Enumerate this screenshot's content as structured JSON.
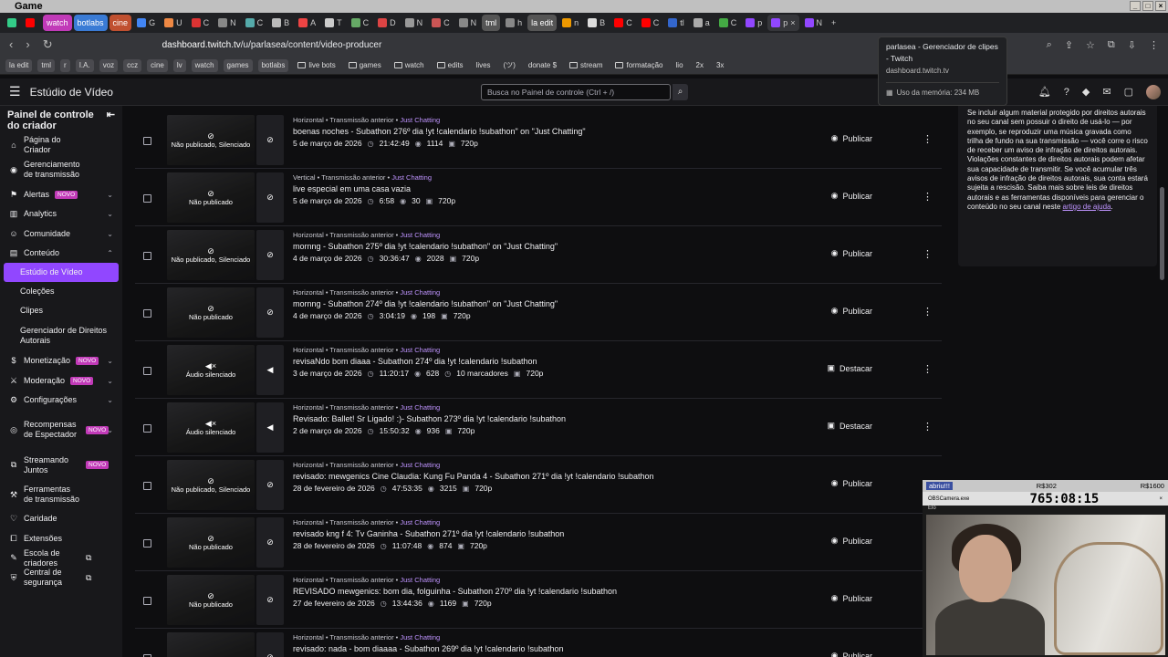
{
  "window": {
    "title": "Game"
  },
  "tabs": [
    {
      "label": "",
      "color": "#ff0000"
    },
    {
      "label": "watch",
      "color": "#c13ab8",
      "pill": true
    },
    {
      "label": "botlabs",
      "color": "#3a7bd5",
      "pill": true
    },
    {
      "label": "cine",
      "color": "#c05030",
      "pill": true
    },
    {
      "label": "G",
      "color": "#4285f4"
    },
    {
      "label": "U",
      "color": "#e84"
    },
    {
      "label": "C",
      "color": "#d33"
    },
    {
      "label": "N",
      "color": "#888"
    },
    {
      "label": "C",
      "color": "#5aa"
    },
    {
      "label": "B",
      "color": "#bbb"
    },
    {
      "label": "A",
      "color": "#e44"
    },
    {
      "label": "T",
      "color": "#ccc"
    },
    {
      "label": "C",
      "color": "#6a6"
    },
    {
      "label": "D",
      "color": "#d44"
    },
    {
      "label": "N",
      "color": "#999"
    },
    {
      "label": "C",
      "color": "#c55"
    },
    {
      "label": "N",
      "color": "#888"
    },
    {
      "label": "tml",
      "color": "#555",
      "pill": true
    },
    {
      "label": "h",
      "color": "#888"
    },
    {
      "label": "la edit",
      "color": "#555",
      "pill": true
    },
    {
      "label": "n",
      "color": "#e90"
    },
    {
      "label": "B",
      "color": "#ddd"
    },
    {
      "label": "C",
      "color": "#f00"
    },
    {
      "label": "C",
      "color": "#f00"
    },
    {
      "label": "tl",
      "color": "#36c"
    },
    {
      "label": "a",
      "color": "#aaa"
    },
    {
      "label": "C",
      "color": "#4a4"
    },
    {
      "label": "p",
      "color": "#9147ff"
    },
    {
      "label": "p",
      "color": "#9147ff",
      "active": true
    },
    {
      "label": "N",
      "color": "#9147ff"
    }
  ],
  "address": {
    "host": "dashboard.twitch.tv",
    "path": "/u/parlasea/content/video-producer"
  },
  "bookmarks": [
    {
      "label": "la edit",
      "pill": true
    },
    {
      "label": "tml",
      "pill": true
    },
    {
      "label": "r",
      "pill": true
    },
    {
      "label": "I.A.",
      "pill": true
    },
    {
      "label": "voz",
      "pill": true
    },
    {
      "label": "ccz",
      "pill": true
    },
    {
      "label": "cine",
      "pill": true
    },
    {
      "label": "lv",
      "pill": true
    },
    {
      "label": "watch",
      "pill": true
    },
    {
      "label": "games",
      "pill": true
    },
    {
      "label": "botlabs",
      "pill": true
    },
    {
      "label": "live bots",
      "folder": true
    },
    {
      "label": "games",
      "folder": true
    },
    {
      "label": "watch",
      "folder": true
    },
    {
      "label": "edits",
      "folder": true
    },
    {
      "label": "lives"
    },
    {
      "label": "(ツ)"
    },
    {
      "label": "donate $"
    },
    {
      "label": "stream",
      "folder": true
    },
    {
      "label": "formatação",
      "folder": true
    },
    {
      "label": "lio"
    },
    {
      "label": "2x"
    },
    {
      "label": "3x"
    }
  ],
  "tooltip": {
    "title": "parlasea - Gerenciador de clipes - Twitch",
    "host": "dashboard.twitch.tv",
    "memory": "Uso da memória: 234 MB"
  },
  "topnav": {
    "title": "Estúdio de Vídeo",
    "search_placeholder": "Busca no Painel de controle (Ctrl + /)"
  },
  "sidebar": {
    "heading": "Painel de controle do criador",
    "items": [
      {
        "label": "Página do Criador",
        "icon": "home-icon",
        "glyph": "⌂"
      },
      {
        "label": "Gerenciamento de transmissão",
        "icon": "broadcast-icon",
        "glyph": "◉"
      },
      {
        "label": "Alertas",
        "icon": "alert-icon",
        "glyph": "⚑",
        "badge": "NOVO",
        "chev": "⌄"
      },
      {
        "label": "Analytics",
        "icon": "chart-icon",
        "glyph": "▥",
        "chev": "⌄"
      },
      {
        "label": "Comunidade",
        "icon": "community-icon",
        "glyph": "☺",
        "chev": "⌄"
      },
      {
        "label": "Conteúdo",
        "icon": "content-icon",
        "glyph": "▤",
        "chev": "⌃"
      }
    ],
    "sub": [
      "Estúdio de Vídeo",
      "Coleções",
      "Clipes",
      "Gerenciador de Direitos Autorais"
    ],
    "items2": [
      {
        "label": "Monetização",
        "icon": "money-icon",
        "glyph": "$",
        "badge": "NOVO",
        "chev": "⌄"
      },
      {
        "label": "Moderação",
        "icon": "mod-icon",
        "glyph": "⚔",
        "badge": "NOVO",
        "chev": "⌄"
      },
      {
        "label": "Configurações",
        "icon": "gear-icon",
        "glyph": "⚙",
        "chev": "⌄"
      },
      {
        "label": "Recompensas de Espectador",
        "icon": "reward-icon",
        "glyph": "◎",
        "badge": "NOVO",
        "chev": "⌄"
      },
      {
        "label": "Streamando Juntos",
        "icon": "together-icon",
        "glyph": "⧉",
        "badge": "NOVO"
      },
      {
        "label": "Ferramentas de transmissão",
        "icon": "tools-icon",
        "glyph": "⚒"
      },
      {
        "label": "Caridade",
        "icon": "charity-icon",
        "glyph": "♡"
      },
      {
        "label": "Extensões",
        "icon": "extension-icon",
        "glyph": "⧠"
      },
      {
        "label": "Escola de criadores",
        "icon": "school-icon",
        "glyph": "✎",
        "ext": "⧉"
      },
      {
        "label": "Central de segurança",
        "icon": "shield-icon",
        "glyph": "⛨",
        "ext": "⧉"
      }
    ]
  },
  "videos": [
    {
      "meta": "Horizontal • Transmissão anterior •",
      "cat": "Just Chatting",
      "title": "boenas noches - Subathon 276º dia !yt !calendario !subathon\" on \"Just Chatting\"",
      "date": "5 de março de 2026",
      "dur": "21:42:49",
      "views": "1114",
      "markers": "",
      "res": "720p",
      "overlay": "Não publicado, Silenciado",
      "action": "Publicar"
    },
    {
      "meta": "Vertical • Transmissão anterior •",
      "cat": "Just Chatting",
      "title": "live especial em uma casa vazia",
      "date": "5 de março de 2026",
      "dur": "6:58",
      "views": "30",
      "markers": "",
      "res": "720p",
      "overlay": "Não publicado",
      "action": "Publicar"
    },
    {
      "meta": "Horizontal • Transmissão anterior •",
      "cat": "Just Chatting",
      "title": "mornng - Subathon 275º dia !yt !calendario !subathon\" on \"Just Chatting\"",
      "date": "4 de março de 2026",
      "dur": "30:36:47",
      "views": "2028",
      "markers": "",
      "res": "720p",
      "overlay": "Não publicado, Silenciado",
      "action": "Publicar"
    },
    {
      "meta": "Horizontal • Transmissão anterior •",
      "cat": "Just Chatting",
      "title": "mornng - Subathon 274º dia !yt !calendario !subathon\" on \"Just Chatting\"",
      "date": "4 de março de 2026",
      "dur": "3:04:19",
      "views": "198",
      "markers": "",
      "res": "720p",
      "overlay": "Não publicado",
      "action": "Publicar"
    },
    {
      "meta": "Horizontal • Transmissão anterior •",
      "cat": "Just Chatting",
      "title": "revisaNdo bom diaaa - Subathon 274º dia !yt !calendario !subathon",
      "date": "3 de março de 2026",
      "dur": "11:20:17",
      "views": "628",
      "markers": "10 marcadores",
      "res": "720p",
      "overlay": "Áudio silenciado",
      "action": "Destacar"
    },
    {
      "meta": "Horizontal • Transmissão anterior •",
      "cat": "Just Chatting",
      "title": "Revisado: Ballet! Sr Ligado! :)- Subathon 273º dia !yt !calendario !subathon",
      "date": "2 de março de 2026",
      "dur": "15:50:32",
      "views": "936",
      "markers": "",
      "res": "720p",
      "overlay": "Áudio silenciado",
      "action": "Destacar"
    },
    {
      "meta": "Horizontal • Transmissão anterior •",
      "cat": "Just Chatting",
      "title": "revisado: mewgenics Cine Claudia: Kung Fu Panda 4 - Subathon 271º dia !yt !calendario !subathon",
      "date": "28 de fevereiro de 2026",
      "dur": "47:53:35",
      "views": "3215",
      "markers": "",
      "res": "720p",
      "overlay": "Não publicado, Silenciado",
      "action": "Publicar"
    },
    {
      "meta": "Horizontal • Transmissão anterior •",
      "cat": "Just Chatting",
      "title": "revisado kng f 4: Tv Ganinha - Subathon 271º dia !yt !calendario !subathon",
      "date": "28 de fevereiro de 2026",
      "dur": "11:07:48",
      "views": "874",
      "markers": "",
      "res": "720p",
      "overlay": "Não publicado",
      "action": "Publicar"
    },
    {
      "meta": "Horizontal • Transmissão anterior •",
      "cat": "Just Chatting",
      "title": "REVISADO mewgenics: bom dia, folguinha - Subathon 270º dia !yt !calendario !subathon",
      "date": "27 de fevereiro de 2026",
      "dur": "13:44:36",
      "views": "1169",
      "markers": "",
      "res": "720p",
      "overlay": "Não publicado",
      "action": "Publicar"
    },
    {
      "meta": "Horizontal • Transmissão anterior •",
      "cat": "Just Chatting",
      "title": "revisado: nada - bom diaaaa - Subathon 269º dia !yt !calendario !subathon",
      "date": "",
      "dur": "",
      "views": "",
      "markers": "",
      "res": "",
      "overlay": "",
      "action": "Publicar"
    }
  ],
  "copyright": {
    "text": "Se incluir algum material protegido por direitos autorais no seu canal sem possuir o direito de usá-lo — por exemplo, se reproduzir uma música gravada como trilha de fundo na sua transmissão — você corre o risco de receber um aviso de infração de direitos autorais. Violações constantes de direitos autorais podem afetar sua capacidade de transmitir. Se você acumular três avisos de infração de direitos autorais, sua conta estará sujeita a rescisão. Saiba mais sobre leis de direitos autorais e as ferramentas disponíveis para gerenciar o conteúdo no seu canal neste",
    "link": "artigo de ajuda",
    "end": "."
  },
  "camera": {
    "label": "abriu!!!",
    "goal1": "R$302",
    "goal2": "R$1600",
    "app": "OBSCamera.exe",
    "timer": "765:08:15",
    "sub": "Elo"
  },
  "colors": {
    "accent": "#9147ff",
    "badge": "#c13ab8",
    "category": "#bf94ff",
    "bg": "#0e0e10",
    "panel": "#18181b"
  }
}
